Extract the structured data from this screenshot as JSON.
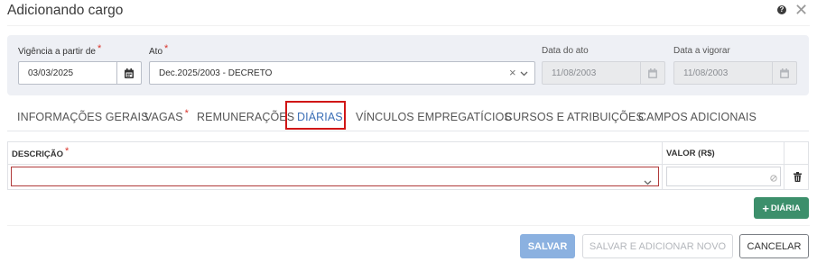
{
  "dialog": {
    "title": "Adicionando cargo",
    "help_symbol": "?",
    "close_symbol": "✕"
  },
  "form": {
    "vigencia": {
      "label": "Vigência a partir de",
      "required_mark": "*",
      "value": "03/03/2025",
      "icon": "calendar-icon"
    },
    "ato": {
      "label": "Ato",
      "required_mark": "*",
      "value": "Dec.2025/2003 - DECRETO",
      "clear_symbol": "×",
      "icon": "chevron-down-icon"
    },
    "data_ato": {
      "label": "Data do ato",
      "value": "11/08/2003",
      "icon": "calendar-icon"
    },
    "data_vigorar": {
      "label": "Data a vigorar",
      "value": "11/08/2003",
      "icon": "calendar-icon"
    }
  },
  "tabs": [
    {
      "label": "INFORMAÇÕES GERAIS",
      "required": false,
      "active": false
    },
    {
      "label": "VAGAS",
      "required": true,
      "required_mark": "*",
      "active": false
    },
    {
      "label": "REMUNERAÇÕES",
      "required": false,
      "active": false
    },
    {
      "label": "DIÁRIAS",
      "required": false,
      "active": true
    },
    {
      "label": "VÍNCULOS EMPREGATÍCIOS",
      "required": false,
      "active": false
    },
    {
      "label": "CURSOS E ATRIBUIÇÕES",
      "required": false,
      "active": false
    },
    {
      "label": "CAMPOS ADICIONAIS",
      "required": false,
      "active": false
    }
  ],
  "table": {
    "headers": {
      "descricao": "DESCRIÇÃO",
      "descricao_required_mark": "*",
      "valor": "VALOR (R$)"
    },
    "rows": [
      {
        "descricao": "",
        "valor": ""
      }
    ]
  },
  "actions": {
    "add_diaria": "DIÁRIA",
    "add_symbol": "+",
    "save": "SALVAR",
    "save_add": "SALVAR E ADICIONAR NOVO",
    "cancel": "CANCELAR"
  },
  "colors": {
    "accent_blue": "#3b6fb6",
    "highlight_red": "#d01616",
    "required_red": "#d9342b",
    "add_green": "#3c8f6b",
    "save_disabled_blue": "#8bb1e0",
    "panel_bg": "#eef0f5"
  }
}
